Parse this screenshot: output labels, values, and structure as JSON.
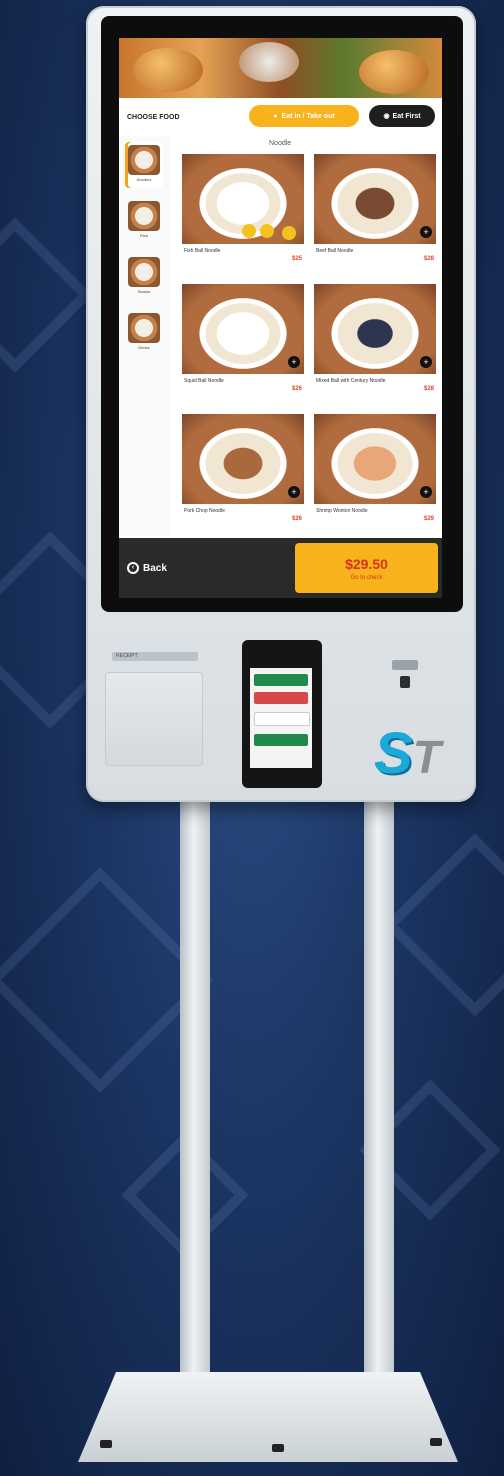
{
  "topbar": {
    "shop_title": "CHOOSE FOOD",
    "takeaway_label": "Eat in / Take out",
    "dinein_label": "Eat First"
  },
  "categories": [
    {
      "label": "Noodles"
    },
    {
      "label": "Rice"
    },
    {
      "label": "Snacks"
    },
    {
      "label": "Drinks"
    }
  ],
  "grid": {
    "title": "Noodle"
  },
  "products": [
    {
      "name": "Fish Ball Noodle",
      "price": "$25"
    },
    {
      "name": "Beef Ball Noodle",
      "price": "$28"
    },
    {
      "name": "Squid Ball Noodle",
      "price": "$26"
    },
    {
      "name": "Mixed Ball with Century Noodle",
      "price": "$28"
    },
    {
      "name": "Pork Chop Noodle",
      "price": "$26"
    },
    {
      "name": "Shrimp Wonton Noodle",
      "price": "$29"
    }
  ],
  "bottom": {
    "back_label": "Back",
    "total_amount": "$29.50",
    "total_sub": "Go to check"
  },
  "hardware": {
    "printer_label": "RECEIPT",
    "brand": "S",
    "brand_t": "T"
  },
  "colors": {
    "accent": "#f7b21c",
    "price": "#e0472c",
    "dark_bar": "#2a2a2a"
  }
}
